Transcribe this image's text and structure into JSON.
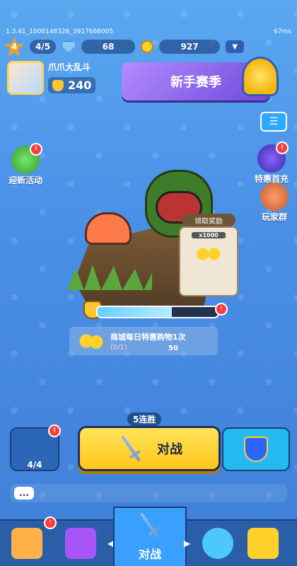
{
  "status": {
    "build": "1.3.41_1000148326_3917686005",
    "ping": "67ms"
  },
  "resources": {
    "level": "4",
    "level_progress": "4/5",
    "gems": "68",
    "coins": "927"
  },
  "profile": {
    "name": "爪爪大乱斗",
    "trophies": "240"
  },
  "season": {
    "title": "新手赛季"
  },
  "side_left": {
    "label": "迎新活动"
  },
  "side_right": [
    {
      "label": "特惠首充"
    },
    {
      "label": "玩家群"
    }
  ],
  "reward": {
    "title": "领取奖励",
    "qty": "x1000"
  },
  "task": {
    "title": "商城每日特惠购物1次",
    "progress": "(0/1)",
    "count": "50"
  },
  "chest": {
    "count": "4/4"
  },
  "streak": {
    "label": "5连胜"
  },
  "battle": {
    "label": "对战"
  },
  "chat": {
    "icon": "..."
  },
  "nav": {
    "center": "对战"
  },
  "progress": {
    "fill": 0.62
  }
}
